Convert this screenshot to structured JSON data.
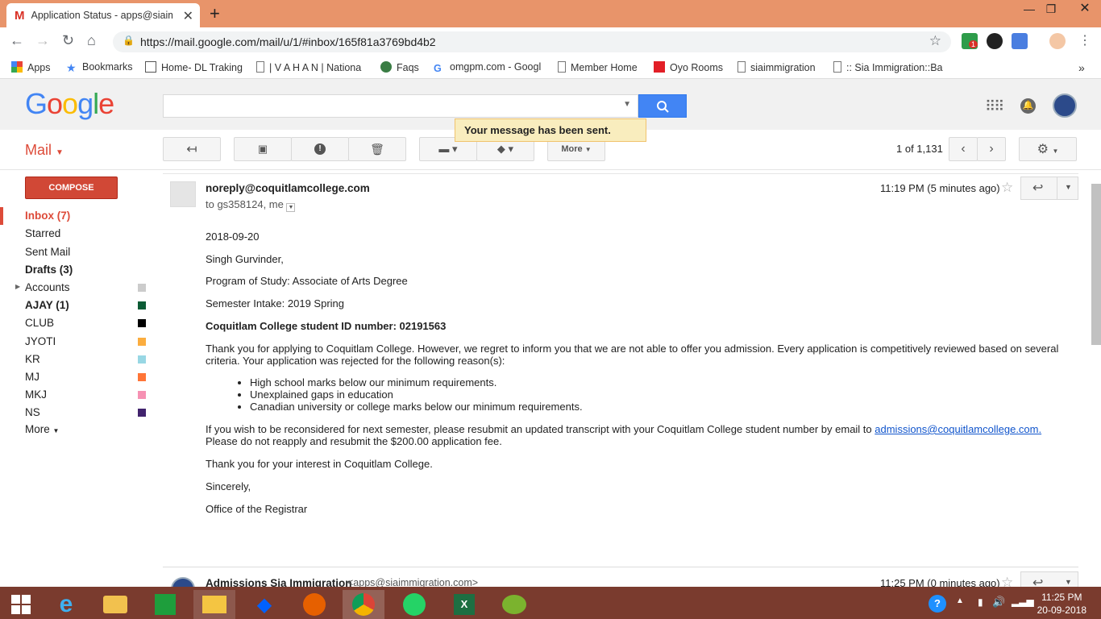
{
  "browser": {
    "tab_title": "Application Status - apps@siaim",
    "tab_icon": "gmail-m-icon",
    "url": "https://mail.google.com/mail/u/1/#inbox/165f81a3769bd4b2",
    "ext_badge": "1"
  },
  "bookmarks": [
    {
      "label": "Apps",
      "icon": "apps-grid-icon"
    },
    {
      "label": "Bookmarks",
      "icon": "star-icon"
    },
    {
      "label": "Home- DL Traking",
      "icon": "image-icon"
    },
    {
      "label": "| V A H A N | Nationa",
      "icon": "page-icon"
    },
    {
      "label": "Faqs",
      "icon": "globe-icon"
    },
    {
      "label": "omgpm.com - Googl",
      "icon": "google-icon"
    },
    {
      "label": "Member Home",
      "icon": "page-icon"
    },
    {
      "label": "Oyo Rooms",
      "icon": "oyo-icon"
    },
    {
      "label": "siaimmigration",
      "icon": "page-icon"
    },
    {
      "label": ":: Sia Immigration::Ba",
      "icon": "page-icon"
    }
  ],
  "header": {
    "logo": "Google",
    "toast": "Your message has been sent."
  },
  "toolbar": {
    "mail_label": "Mail",
    "more_label": "More",
    "pager": "1 of 1,131"
  },
  "sidebar": {
    "compose": "COMPOSE",
    "items": [
      {
        "label": "Inbox (7)",
        "color": ""
      },
      {
        "label": "Starred",
        "color": ""
      },
      {
        "label": "Sent Mail",
        "color": ""
      },
      {
        "label": "Drafts (3)",
        "color": ""
      },
      {
        "label": "Accounts",
        "color": "#cccccc"
      },
      {
        "label": "AJAY (1)",
        "color": "#0b5b35"
      },
      {
        "label": "CLUB",
        "color": "#000000"
      },
      {
        "label": "JYOTI",
        "color": "#fbad3f"
      },
      {
        "label": "KR",
        "color": "#98d7e4"
      },
      {
        "label": "MJ",
        "color": "#ff7537"
      },
      {
        "label": "MKJ",
        "color": "#f691b3"
      },
      {
        "label": "NS",
        "color": "#41236d"
      },
      {
        "label": "More",
        "color": ""
      }
    ]
  },
  "message": {
    "sender": "noreply@coquitlamcollege.com",
    "to": "to gs358124, me",
    "time": "11:19 PM (5 minutes ago)",
    "date": "2018-09-20",
    "greeting": "Singh Gurvinder,",
    "program": "Program of Study: Associate of Arts Degree",
    "intake": "Semester Intake: 2019 Spring",
    "student_id": "Coquitlam College student ID number: 02191563",
    "para1": "Thank you for applying to Coquitlam College.  However, we regret to inform you that we are not able to offer you admission.  Every application is competitively reviewed based on several criteria. Your application was rejected for the following reason(s):",
    "reasons": [
      "High school marks below our minimum requirements.",
      "Unexplained gaps in education",
      "Canadian university or college marks below our minimum requirements."
    ],
    "para2_a": "If you wish to be reconsidered for next semester, please resubmit an updated transcript with your Coquitlam College student number by email to ",
    "para2_link": "admissions@coquitlamcollege.com.",
    "para2_b": " Please do not reapply and resubmit the $200.00 application fee.",
    "thanks": "Thank you for your interest in Coquitlam College.",
    "sincerely": "Sincerely,",
    "signoff": "Office of the Registrar"
  },
  "next_message": {
    "sender": "Admissions Sia Immigration",
    "email": "<apps@siaimmigration.com>",
    "time": "11:25 PM (0 minutes ago)"
  },
  "taskbar": {
    "time": "11:25 PM",
    "date": "20-09-2018"
  }
}
